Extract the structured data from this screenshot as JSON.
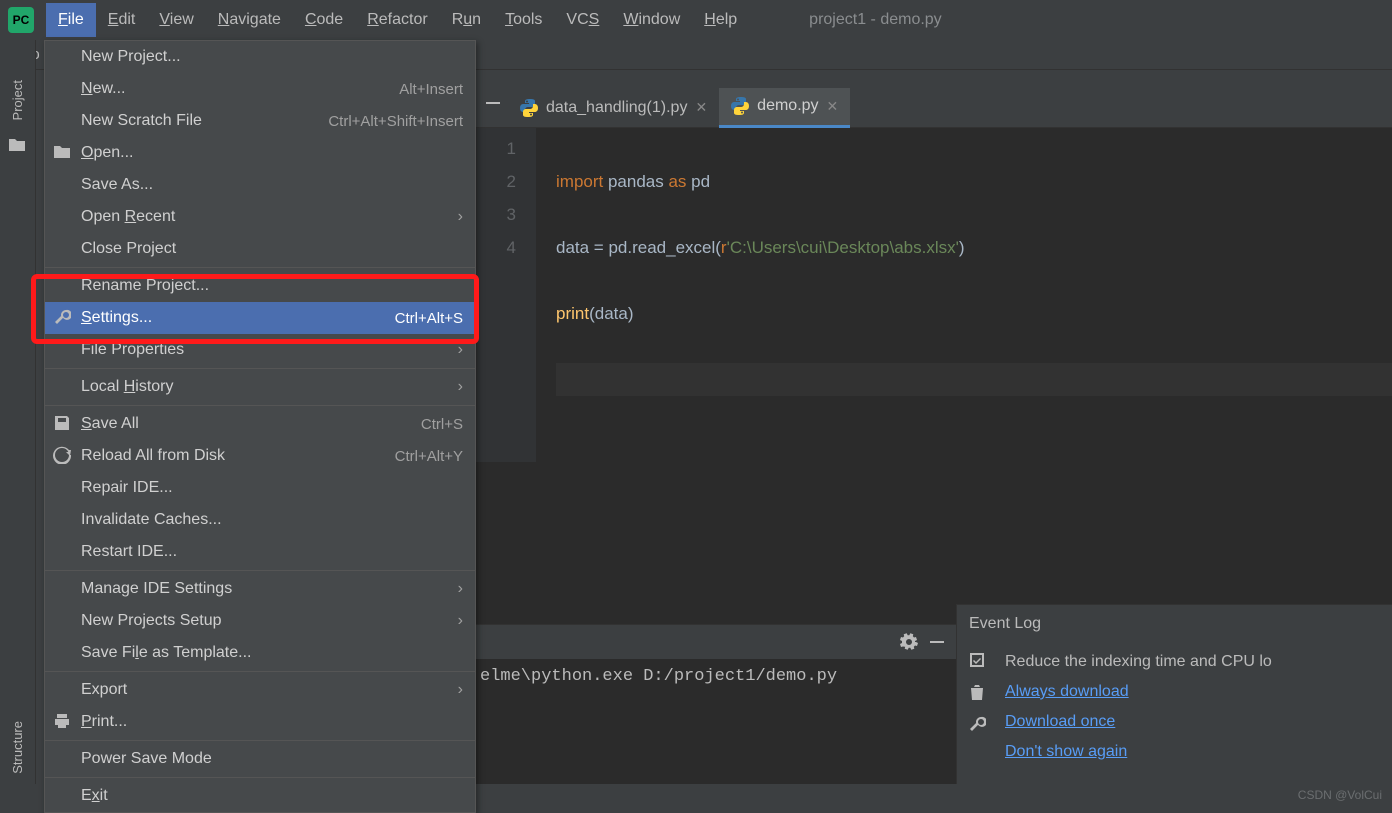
{
  "app_icon_text": "PC",
  "menubar": {
    "items": [
      "File",
      "Edit",
      "View",
      "Navigate",
      "Code",
      "Refactor",
      "Run",
      "Tools",
      "VCS",
      "Window",
      "Help"
    ],
    "underlines": [
      "F",
      "E",
      "V",
      "N",
      "C",
      "R",
      "u",
      "T",
      "S",
      "W",
      "H"
    ],
    "active": "File"
  },
  "window_title": "project1 - demo.py",
  "breadcrumb": "pro",
  "left_strip": {
    "top": "Project",
    "bottom": "Structure"
  },
  "file_menu": [
    {
      "label": "New Project...",
      "shortcut": "",
      "icon": "",
      "sep": false
    },
    {
      "label": "New...",
      "shortcut": "Alt+Insert",
      "icon": "",
      "sep": false,
      "underline": "N"
    },
    {
      "label": "New Scratch File",
      "shortcut": "Ctrl+Alt+Shift+Insert",
      "icon": "",
      "sep": false
    },
    {
      "label": "Open...",
      "shortcut": "",
      "icon": "folder",
      "sep": false,
      "underline": "O"
    },
    {
      "label": "Save As...",
      "shortcut": "",
      "icon": "",
      "sep": false
    },
    {
      "label": "Open Recent",
      "shortcut": "",
      "icon": "",
      "sep": false,
      "arrow": true,
      "underline": "R"
    },
    {
      "label": "Close Project",
      "shortcut": "",
      "icon": "",
      "sep": false
    },
    {
      "label": "Rename Project...",
      "shortcut": "",
      "icon": "",
      "sep": true
    },
    {
      "label": "Settings...",
      "shortcut": "Ctrl+Alt+S",
      "icon": "wrench",
      "sep": false,
      "selected": true,
      "underline": "S"
    },
    {
      "label": "File Properties",
      "shortcut": "",
      "icon": "",
      "sep": false,
      "arrow": true
    },
    {
      "label": "Local History",
      "shortcut": "",
      "icon": "",
      "sep": true,
      "arrow": true,
      "underline": "H"
    },
    {
      "label": "Save All",
      "shortcut": "Ctrl+S",
      "icon": "save",
      "sep": true,
      "underline": "S"
    },
    {
      "label": "Reload All from Disk",
      "shortcut": "Ctrl+Alt+Y",
      "icon": "reload",
      "sep": false
    },
    {
      "label": "Repair IDE...",
      "shortcut": "",
      "icon": "",
      "sep": false
    },
    {
      "label": "Invalidate Caches...",
      "shortcut": "",
      "icon": "",
      "sep": false
    },
    {
      "label": "Restart IDE...",
      "shortcut": "",
      "icon": "",
      "sep": false
    },
    {
      "label": "Manage IDE Settings",
      "shortcut": "",
      "icon": "",
      "sep": true,
      "arrow": true
    },
    {
      "label": "New Projects Setup",
      "shortcut": "",
      "icon": "",
      "sep": false,
      "arrow": true
    },
    {
      "label": "Save File as Template...",
      "shortcut": "",
      "icon": "",
      "sep": false,
      "underline": "l"
    },
    {
      "label": "Export",
      "shortcut": "",
      "icon": "",
      "sep": true,
      "arrow": true
    },
    {
      "label": "Print...",
      "shortcut": "",
      "icon": "print",
      "sep": false,
      "underline": "P"
    },
    {
      "label": "Power Save Mode",
      "shortcut": "",
      "icon": "",
      "sep": true
    },
    {
      "label": "Exit",
      "shortcut": "",
      "icon": "",
      "sep": true,
      "underline": "x"
    }
  ],
  "tabs": [
    {
      "name": "data_handling(1).py",
      "active": false
    },
    {
      "name": "demo.py",
      "active": true
    }
  ],
  "gutter": [
    "1",
    "2",
    "3",
    "4"
  ],
  "code": {
    "line1": {
      "kw1": "import",
      "t1": " pandas ",
      "kw2": "as",
      "t2": " pd"
    },
    "line2": {
      "t1": "data = pd.read_excel(",
      "prefix": "r",
      "str": "'C:\\Users\\cui\\Desktop\\abs.xlsx'",
      "t2": ")"
    },
    "line3": {
      "fn": "print",
      "t1": "(data)"
    },
    "line4": ""
  },
  "console_text": "elme\\python.exe D:/project1/demo.py",
  "event_log": {
    "title": "Event Log",
    "desc": "Reduce the indexing time and CPU lo",
    "links": [
      "Always download",
      "Download once",
      "Don't show again"
    ]
  },
  "watermark": "CSDN @VolCui"
}
